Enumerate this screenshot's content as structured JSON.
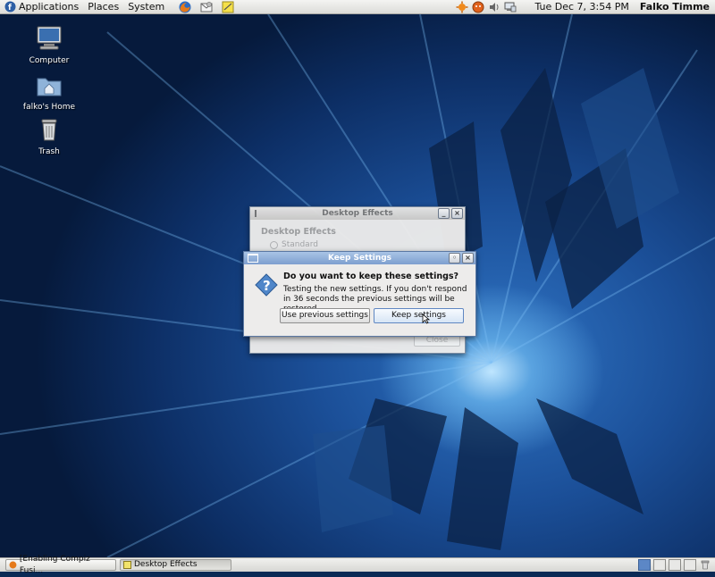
{
  "top_panel": {
    "menus": {
      "applications": "Applications",
      "places": "Places",
      "system": "System"
    },
    "clock": "Tue Dec  7,  3:54 PM",
    "user": "Falko Timme"
  },
  "desktop": {
    "icons": [
      {
        "label": "Computer"
      },
      {
        "label": "falko's Home"
      },
      {
        "label": "Trash"
      }
    ]
  },
  "desktop_effects_window": {
    "title": "Desktop Effects",
    "heading": "Desktop Effects",
    "option_standard": "Standard",
    "close_label": "Close"
  },
  "keep_settings_dialog": {
    "title": "Keep Settings",
    "question": "Do you want to keep these settings?",
    "message": "Testing the new settings. If you don't respond in 36 seconds the previous settings will be restored.",
    "use_previous_label": "Use previous settings",
    "keep_label": "Keep settings"
  },
  "bottom_panel": {
    "tasks": [
      {
        "label": "[Enabling Compiz Fusi..."
      },
      {
        "label": "Desktop Effects"
      }
    ]
  },
  "colors": {
    "dialog_titlebar": "#7d9fcf",
    "active_workspace": "#5c87c6"
  }
}
